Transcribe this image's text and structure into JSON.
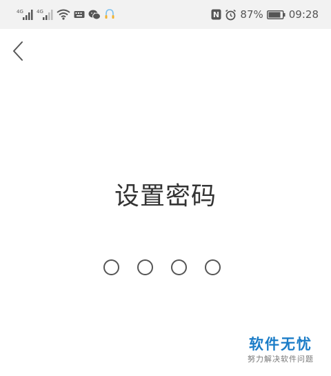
{
  "status_bar": {
    "signal_1_label": "4G",
    "signal_2_label": "4G",
    "nfc_label": "N",
    "battery_percent": "87%",
    "time": "09:28",
    "icons": [
      "signal-bars-icon",
      "signal-bars-icon",
      "wifi-icon",
      "keyboard-icon",
      "wechat-icon",
      "assistant-icon",
      "nfc-icon",
      "alarm-icon",
      "battery-icon"
    ]
  },
  "header": {
    "back_icon": "chevron-left-icon"
  },
  "main": {
    "title": "设置密码",
    "pin_length": 4
  },
  "watermark": {
    "brand": "软件无忧",
    "tagline": "努力解决软件问题",
    "color": "#1a7cc7"
  }
}
